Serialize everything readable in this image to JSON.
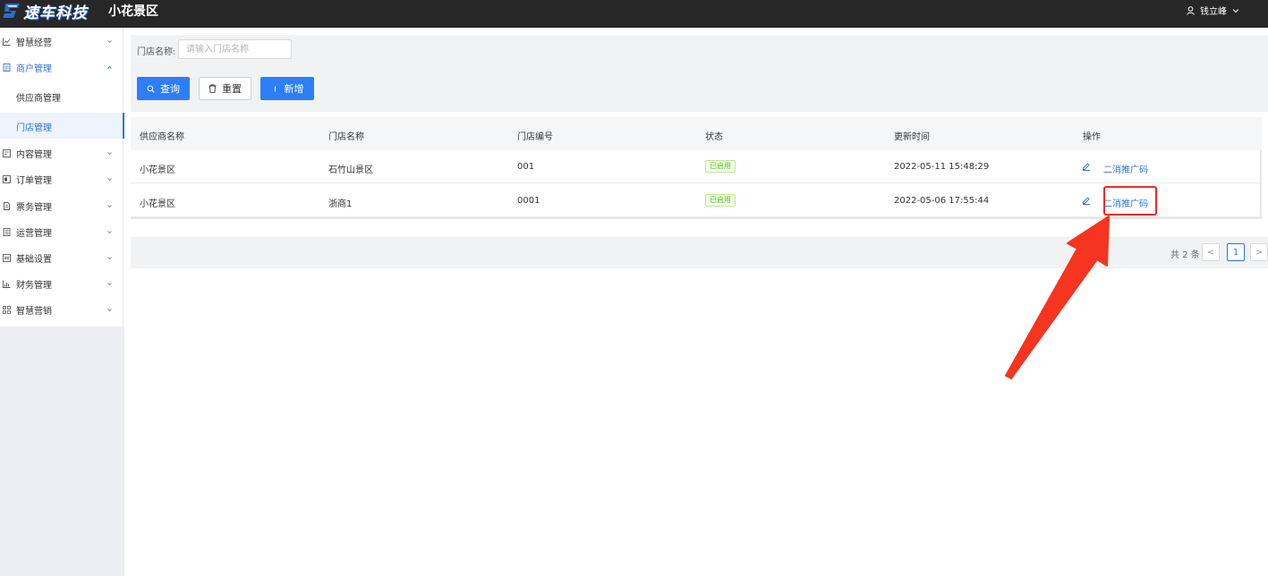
{
  "header": {
    "brand": "速车科技",
    "title": "小花景区",
    "user": "钱立峰"
  },
  "sidebar": {
    "items": [
      {
        "label": "智慧经营",
        "icon": "line-chart-icon"
      },
      {
        "label": "商户管理",
        "icon": "list-icon"
      },
      {
        "label": "内容管理",
        "icon": "content-icon"
      },
      {
        "label": "订单管理",
        "icon": "order-icon"
      },
      {
        "label": "票务管理",
        "icon": "ticket-icon"
      },
      {
        "label": "运营管理",
        "icon": "operation-icon"
      },
      {
        "label": "基础设置",
        "icon": "settings-icon"
      },
      {
        "label": "财务管理",
        "icon": "bar-chart-icon"
      },
      {
        "label": "智慧营销",
        "icon": "grid-icon"
      }
    ],
    "sub_items": [
      {
        "label": "供应商管理"
      },
      {
        "label": "门店管理"
      }
    ]
  },
  "filter": {
    "label": "门店名称:",
    "placeholder": "请输入门店名称",
    "value": "",
    "query_label": "查询",
    "reset_label": "重置",
    "add_label": "新增"
  },
  "table": {
    "columns": [
      "供应商名称",
      "门店名称",
      "门店编号",
      "状态",
      "更新时间",
      "操作"
    ],
    "rows": [
      {
        "supplier": "小花景区",
        "store": "石竹山景区",
        "code": "001",
        "status": "已启用",
        "updated": "2022-05-11 15:48:29",
        "action": "二消推广码"
      },
      {
        "supplier": "小花景区",
        "store": "浙商1",
        "code": "0001",
        "status": "已启用",
        "updated": "2022-05-06 17:55:44",
        "action": "二消推广码"
      }
    ]
  },
  "pagination": {
    "total": "共 2 条",
    "current_page": "1",
    "prev": "<",
    "next": ">"
  },
  "colors": {
    "accent": "#2d7ef7",
    "header_bg": "#272727",
    "annotation": "#f02a2a",
    "status_green": "#52c41a"
  }
}
